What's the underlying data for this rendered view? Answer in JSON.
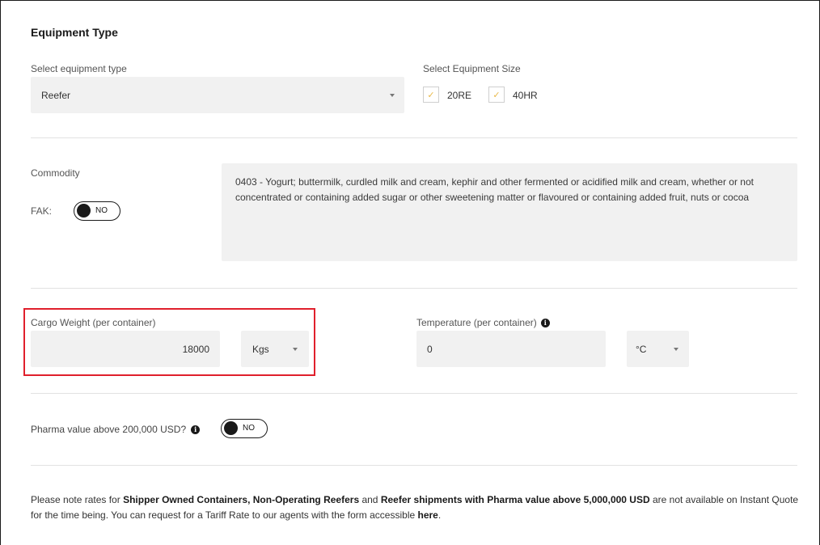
{
  "equipment": {
    "section_title": "Equipment Type",
    "type_label": "Select equipment type",
    "type_value": "Reefer",
    "size_label": "Select Equipment Size",
    "sizes": [
      {
        "label": "20RE",
        "checked": true
      },
      {
        "label": "40HR",
        "checked": true
      }
    ]
  },
  "commodity": {
    "label": "Commodity",
    "fak_label": "FAK:",
    "fak_toggle": "NO",
    "description": "0403 - Yogurt; buttermilk, curdled milk and cream, kephir and other fermented or acidified milk and cream, whether or not concentrated or containing added sugar or other sweetening matter or flavoured or containing added fruit, nuts or cocoa"
  },
  "cargo": {
    "weight_label": "Cargo Weight (per container)",
    "weight_value": "18000",
    "weight_unit": "Kgs",
    "temp_label": "Temperature (per container)",
    "temp_value": "0",
    "temp_unit": "°C"
  },
  "pharma": {
    "label": "Pharma value above 200,000 USD?",
    "toggle": "NO"
  },
  "note": {
    "t1": "Please note rates for ",
    "b1": "Shipper Owned Containers, Non-Operating Reefers",
    "t2": " and ",
    "b2": "Reefer shipments with Pharma value above 5,000,000 USD",
    "t3": " are not available on Instant Quote for the time being. You can request for a Tariff Rate to our agents with the form accessible ",
    "link": "here",
    "t4": "."
  },
  "colors": {
    "check_accent": "#e9b949",
    "highlight_border": "#e0202c",
    "field_bg": "#f1f1f1"
  }
}
